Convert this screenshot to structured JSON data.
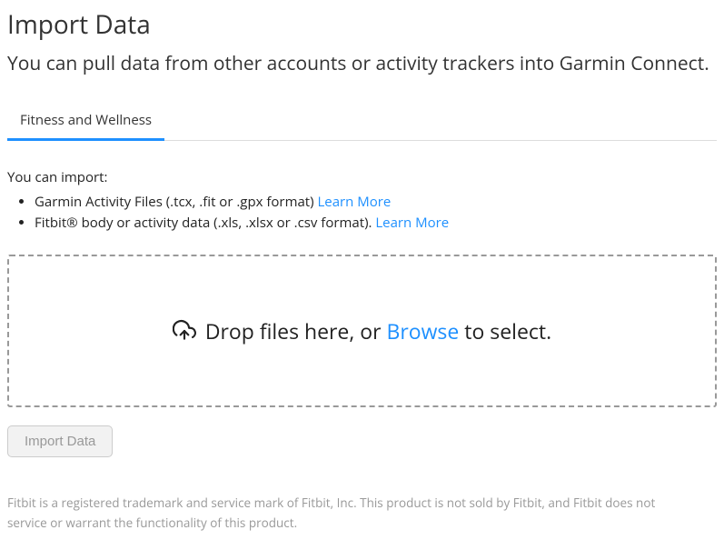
{
  "page": {
    "title": "Import Data",
    "subtitle": "You can pull data from other accounts or activity trackers into Garmin Connect."
  },
  "tabs": [
    {
      "label": "Fitness and Wellness",
      "active": true
    }
  ],
  "import": {
    "intro": "You can import:",
    "items": [
      {
        "text": "Garmin Activity Files (.tcx, .fit or .gpx format) ",
        "link": "Learn More"
      },
      {
        "text": "Fitbit® body or activity data (.xls, .xlsx or .csv format). ",
        "link": "Learn More"
      }
    ]
  },
  "dropzone": {
    "pre": "Drop files here, or ",
    "link": "Browse",
    "post": " to select."
  },
  "buttons": {
    "import": "Import Data"
  },
  "footer": {
    "note": "Fitbit is a registered trademark and service mark of Fitbit, Inc. This product is not sold by Fitbit, and Fitbit does not service or warrant the functionality of this product."
  }
}
